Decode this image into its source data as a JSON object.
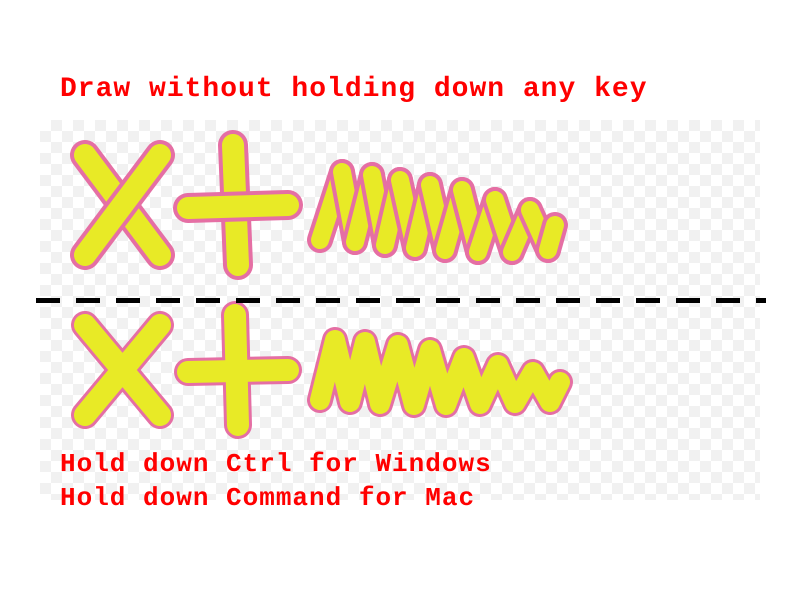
{
  "labels": {
    "top": "Draw without holding down any key",
    "bottom_line1": "Hold down Ctrl for Windows",
    "bottom_line2": "Hold down Command for Mac"
  },
  "colors": {
    "text": "#ff0000",
    "stroke_fill": "#e8ea26",
    "stroke_outline": "#e56fa4",
    "divider": "#000000",
    "checker_light": "#ffffff",
    "checker_dark": "#f0f0f0"
  },
  "diagram": {
    "rows": [
      {
        "mode": "no-key",
        "symbols": [
          "x-mark",
          "plus-mark",
          "squiggle"
        ],
        "merged_outline": false
      },
      {
        "mode": "ctrl-or-command",
        "symbols": [
          "x-mark",
          "plus-mark",
          "squiggle"
        ],
        "merged_outline": true
      }
    ]
  }
}
